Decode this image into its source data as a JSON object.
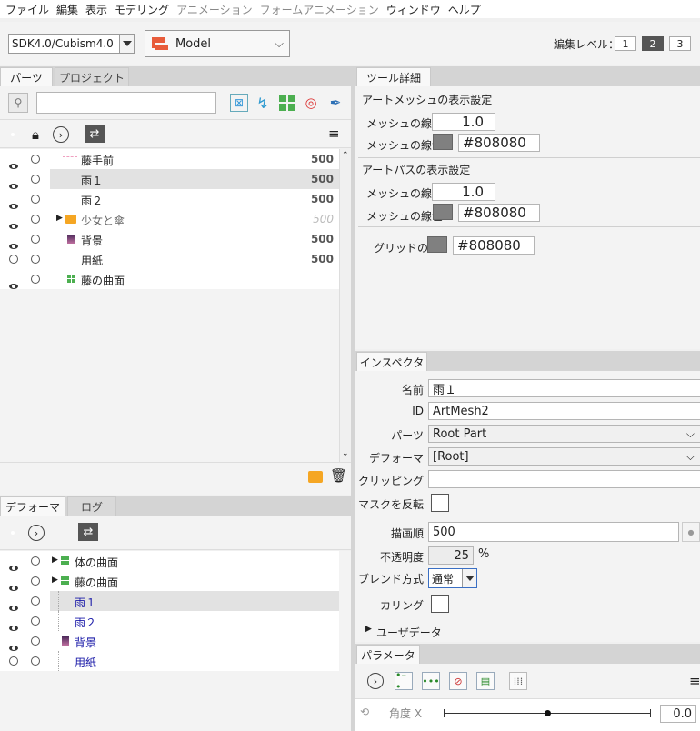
{
  "menu": [
    "ファイル",
    "編集",
    "表示",
    "モデリング",
    "アニメーション",
    "フォームアニメーション",
    "ウィンドウ",
    "ヘルプ"
  ],
  "menu_dim": [
    false,
    false,
    false,
    false,
    true,
    true,
    false,
    false
  ],
  "toolbar": {
    "sdk": "SDK4.0/Cubism4.0",
    "model": "Model",
    "edit_level_label": "編集レベル：",
    "levels": [
      "1",
      "2",
      "3"
    ],
    "active_level": "2"
  },
  "tabs_left": {
    "parts": "パーツ",
    "project": "プロジェクト"
  },
  "parts": [
    {
      "label": "藤手前",
      "value": "500",
      "visible": true,
      "dim": false
    },
    {
      "label": "雨１",
      "value": "500",
      "visible": true,
      "dim": false
    },
    {
      "label": "雨２",
      "value": "500",
      "visible": true,
      "dim": false
    },
    {
      "label": "少女と傘",
      "value": "500",
      "visible": true,
      "dim": true
    },
    {
      "label": "背景",
      "value": "500",
      "visible": true,
      "dim": false
    },
    {
      "label": "用紙",
      "value": "500",
      "visible": false,
      "dim": false
    },
    {
      "label": "藤の曲面",
      "value": "",
      "visible": true,
      "dim": false
    }
  ],
  "tabs_deformer": {
    "deformer": "デフォーマ",
    "log": "ログ"
  },
  "deformers": [
    {
      "label": "体の曲面",
      "visible": true
    },
    {
      "label": "藤の曲面",
      "visible": true
    },
    {
      "label": "雨１",
      "visible": true
    },
    {
      "label": "雨２",
      "visible": true
    },
    {
      "label": "背景",
      "visible": true
    },
    {
      "label": "用紙",
      "visible": false
    }
  ],
  "tool_detail": {
    "tab": "ツール詳細",
    "mesh_section": "アートメッシュの表示設定",
    "mesh_width_label": "メッシュの線幅",
    "mesh_width": "1.0",
    "mesh_color_label": "メッシュの線色",
    "mesh_color": "#808080",
    "path_section": "アートパスの表示設定",
    "path_width_label": "メッシュの線幅",
    "path_width": "1.0",
    "path_color_label": "メッシュの線色",
    "path_color": "#808080",
    "grid_label": "グリッドの色",
    "grid_color": "#808080"
  },
  "inspector": {
    "tab": "インスペクタ",
    "name_label": "名前",
    "name": "雨１",
    "id_label": "ID",
    "id": "ArtMesh2",
    "parts_label": "パーツ",
    "parts": "Root Part",
    "deformer_label": "デフォーマ",
    "deformer": "[Root]",
    "clipping_label": "クリッピング",
    "clipping": "",
    "invert_mask_label": "マスクを反転",
    "draw_order_label": "描画順",
    "draw_order": "500",
    "opacity_label": "不透明度",
    "opacity": "25",
    "opacity_unit": "%",
    "blend_label": "ブレンド方式",
    "blend": "通常",
    "culling_label": "カリング",
    "user_data": "ユーザデータ"
  },
  "parameters": {
    "tab": "パラメータ",
    "param_name": "角度 X",
    "param_value": "0.0",
    "param_position": 0.5
  },
  "colors": {
    "accent_blue": "#1a1aa8",
    "selected_row": "#e2e2e2",
    "swatch": "#808080"
  }
}
